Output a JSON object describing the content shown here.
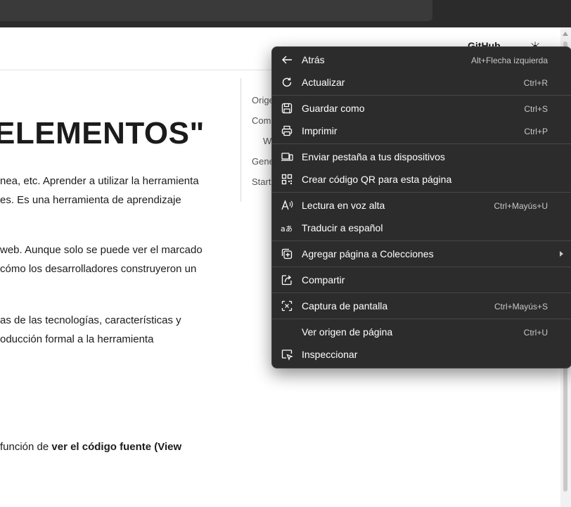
{
  "header": {
    "right_link": "GitHub"
  },
  "page": {
    "title": "ELEMENTOS\"",
    "paragraphs": [
      [
        "nea, etc. Aprender a utilizar la herramienta",
        "es. Es una herramienta de aprendizaje"
      ],
      [
        "web. Aunque solo se puede ver el marcado",
        "cómo los desarrolladores construyeron un"
      ],
      [
        "as de las tecnologías, características y",
        "oducción formal a la herramienta"
      ]
    ],
    "last_line_prefix": "función de ",
    "last_line_bold": "ver el código fuente (View"
  },
  "toc": [
    "Orige",
    "Como",
    "W",
    "Gene",
    "Start"
  ],
  "context_menu": {
    "items": [
      {
        "label": "Atrás",
        "shortcut": "Alt+Flecha izquierda",
        "icon": "back-arrow-icon"
      },
      {
        "label": "Actualizar",
        "shortcut": "Ctrl+R",
        "icon": "refresh-icon"
      },
      {
        "label": "Guardar como",
        "shortcut": "Ctrl+S",
        "icon": "save-icon"
      },
      {
        "label": "Imprimir",
        "shortcut": "Ctrl+P",
        "icon": "print-icon"
      },
      {
        "label": "Enviar pestaña a tus dispositivos",
        "shortcut": "",
        "icon": "devices-icon"
      },
      {
        "label": "Crear código QR para esta página",
        "shortcut": "",
        "icon": "qr-code-icon"
      },
      {
        "label": "Lectura en voz alta",
        "shortcut": "Ctrl+Mayús+U",
        "icon": "read-aloud-icon"
      },
      {
        "label": "Traducir a español",
        "shortcut": "",
        "icon": "translate-icon"
      },
      {
        "label": "Agregar página a Colecciones",
        "shortcut": "",
        "icon": "collections-icon"
      },
      {
        "label": "Compartir",
        "shortcut": "",
        "icon": "share-icon"
      },
      {
        "label": "Captura de pantalla",
        "shortcut": "Ctrl+Mayús+S",
        "icon": "screenshot-icon"
      },
      {
        "label": "Ver origen de página",
        "shortcut": "Ctrl+U",
        "icon": ""
      },
      {
        "label": "Inspeccionar",
        "shortcut": "",
        "icon": "inspect-icon"
      }
    ]
  },
  "colors": {
    "menu_bg": "#2c2c2c",
    "menu_text": "#ffffff",
    "menu_shortcut": "#c8c8c8",
    "separator": "#474747",
    "page_bg": "#ffffff"
  }
}
